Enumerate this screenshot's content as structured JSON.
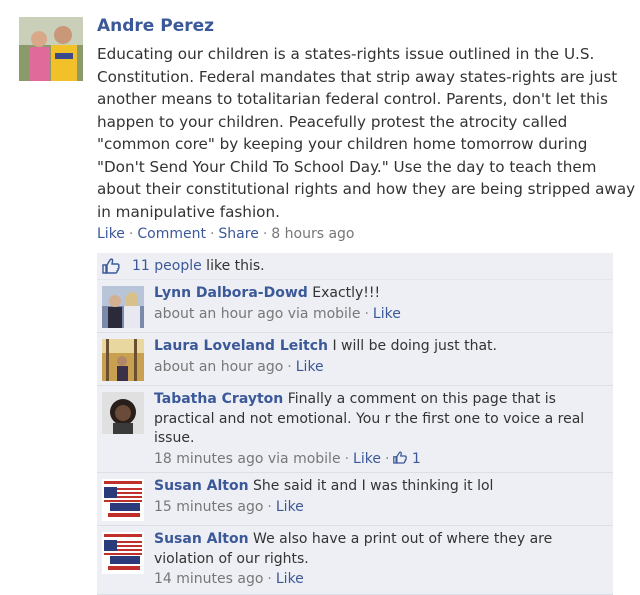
{
  "post": {
    "author": "Andre Perez",
    "text": "Educating our children is a states-rights issue outlined in the U.S. Constitution. Federal mandates that strip away states-rights are just another means to totalitarian federal control. Parents, don't let this happen to your children. Peacefully protest the atrocity called \"common core\" by keeping your children home tomorrow during \"Don't Send Your Child To School Day.\" Use the day to teach them about their constitutional rights and how they are being stripped away in manipulative fashion.",
    "actions": {
      "like": "Like",
      "comment": "Comment",
      "share": "Share",
      "time": "8 hours ago"
    }
  },
  "likes": {
    "count_label": "11 people",
    "suffix": " like this."
  },
  "comments": [
    {
      "author": "Lynn Dalbora-Dowd",
      "text": " Exactly!!!",
      "time": "about an hour ago via mobile",
      "like": "Like"
    },
    {
      "author": "Laura Loveland Leitch",
      "text": " I will be doing just that.",
      "time": "about an hour ago",
      "like": "Like"
    },
    {
      "author": "Tabatha Crayton",
      "text": " Finally a comment on this page that is practical and not emotional. You r the first one to voice a real issue.",
      "time": "18 minutes ago via mobile",
      "like": "Like",
      "like_count": "1"
    },
    {
      "author": "Susan Alton",
      "text": " She said it and I was thinking it lol",
      "time": "15 minutes ago",
      "like": "Like"
    },
    {
      "author": "Susan Alton",
      "text": " We also have a print out of where they are violation of our rights.",
      "time": "14 minutes ago",
      "like": "Like"
    }
  ],
  "colors": {
    "link": "#3b5998",
    "ufi_bg": "#edeff4",
    "meta": "#777777"
  }
}
